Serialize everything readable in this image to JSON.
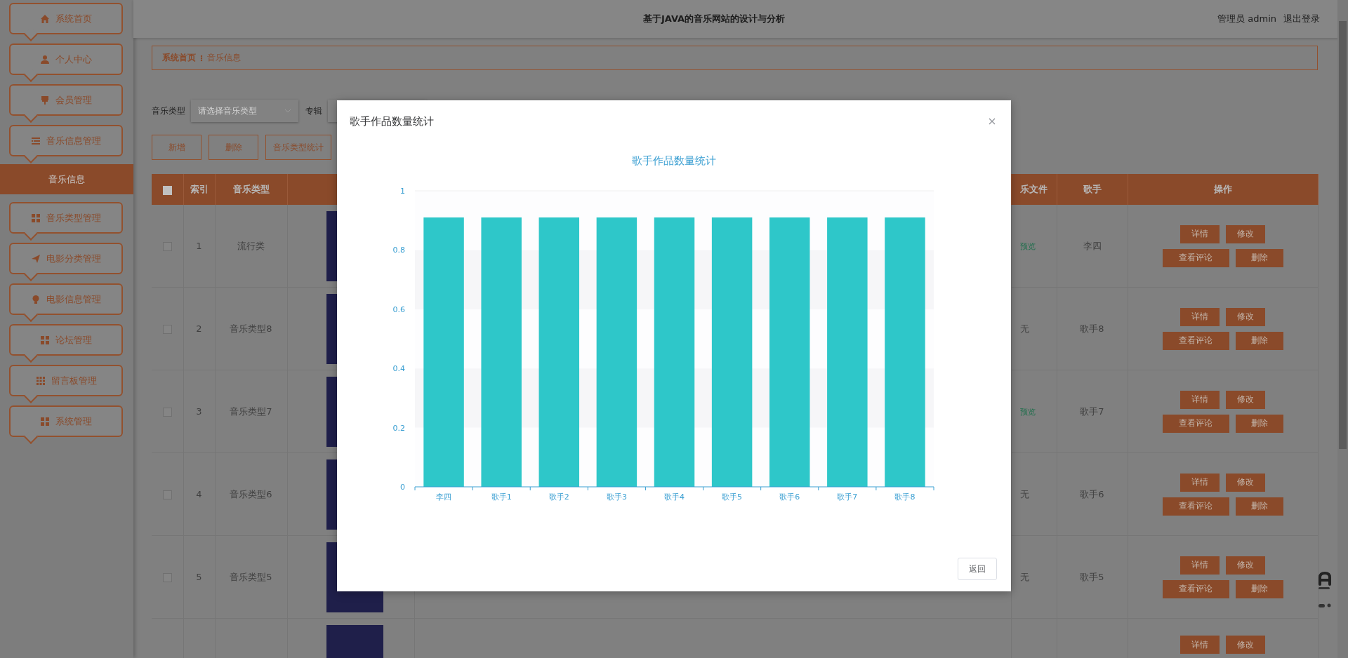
{
  "sidebar": {
    "items": [
      {
        "label": "系统首页",
        "selected": false
      },
      {
        "label": "个人中心",
        "selected": false
      },
      {
        "label": "会员管理",
        "selected": false
      },
      {
        "label": "音乐信息管理",
        "selected": false,
        "children": [
          {
            "label": "音乐信息",
            "selected": true
          }
        ]
      },
      {
        "label": "音乐类型管理",
        "selected": false
      },
      {
        "label": "电影分类管理",
        "selected": false
      },
      {
        "label": "电影信息管理",
        "selected": false
      },
      {
        "label": "论坛管理",
        "selected": false
      },
      {
        "label": "留言板管理",
        "selected": false
      },
      {
        "label": "系统管理",
        "selected": false
      }
    ]
  },
  "header": {
    "title": "基于JAVA的音乐网站的设计与分析",
    "user": "管理员 admin",
    "logout": "退出登录"
  },
  "breadcrumb": [
    "系统首页",
    "音乐信息"
  ],
  "filters": {
    "type_label": "音乐类型",
    "type_placeholder": "请选择音乐类型",
    "album_label": "专辑"
  },
  "actions": [
    "新增",
    "删除",
    "音乐类型统计"
  ],
  "table": {
    "header_checkbox": {
      "checked": false
    },
    "columns": [
      "索引",
      "音乐类型",
      "乐文件",
      "歌手",
      "操作"
    ],
    "rows": [
      {
        "checked": false,
        "index": "1",
        "type": "流行类",
        "file": {
          "text": "预览",
          "kind": "link"
        },
        "singer": "李四",
        "buttons": [
          "详情",
          "修改",
          "查看评论",
          "删除"
        ]
      },
      {
        "checked": false,
        "index": "2",
        "type": "音乐类型8",
        "file": {
          "text": "无",
          "kind": "text"
        },
        "singer": "歌手8",
        "buttons": [
          "详情",
          "修改",
          "查看评论",
          "删除"
        ]
      },
      {
        "checked": false,
        "index": "3",
        "type": "音乐类型7",
        "file": {
          "text": "预览",
          "kind": "link"
        },
        "singer": "歌手7",
        "buttons": [
          "详情",
          "修改",
          "查看评论",
          "删除"
        ]
      },
      {
        "checked": false,
        "index": "4",
        "type": "音乐类型6",
        "file": {
          "text": "无",
          "kind": "text"
        },
        "singer": "歌手6",
        "buttons": [
          "详情",
          "修改",
          "查看评论",
          "删除"
        ]
      },
      {
        "checked": false,
        "index": "5",
        "type": "音乐类型5",
        "file": {
          "text": "无",
          "kind": "text"
        },
        "singer": "歌手5",
        "buttons": [
          "详情",
          "修改",
          "查看评论",
          "删除"
        ]
      },
      {
        "buttons": [
          "详情",
          "修改"
        ]
      }
    ]
  },
  "dialog": {
    "title": "歌手作品数量统计",
    "back_button": "返回",
    "chart_data": {
      "type": "bar",
      "title": "歌手作品数量统计",
      "categories": [
        "李四",
        "歌手1",
        "歌手2",
        "歌手3",
        "歌手4",
        "歌手5",
        "歌手6",
        "歌手7",
        "歌手8"
      ],
      "series": [
        {
          "color": "#2ec7c9",
          "values": [
            0.91,
            0.91,
            0.91,
            0.91,
            0.91,
            0.91,
            0.91,
            0.91,
            0.91
          ]
        }
      ],
      "ylim": [
        0,
        1
      ],
      "yticks": [
        0,
        0.2,
        0.4,
        0.6,
        0.8,
        1
      ]
    }
  }
}
